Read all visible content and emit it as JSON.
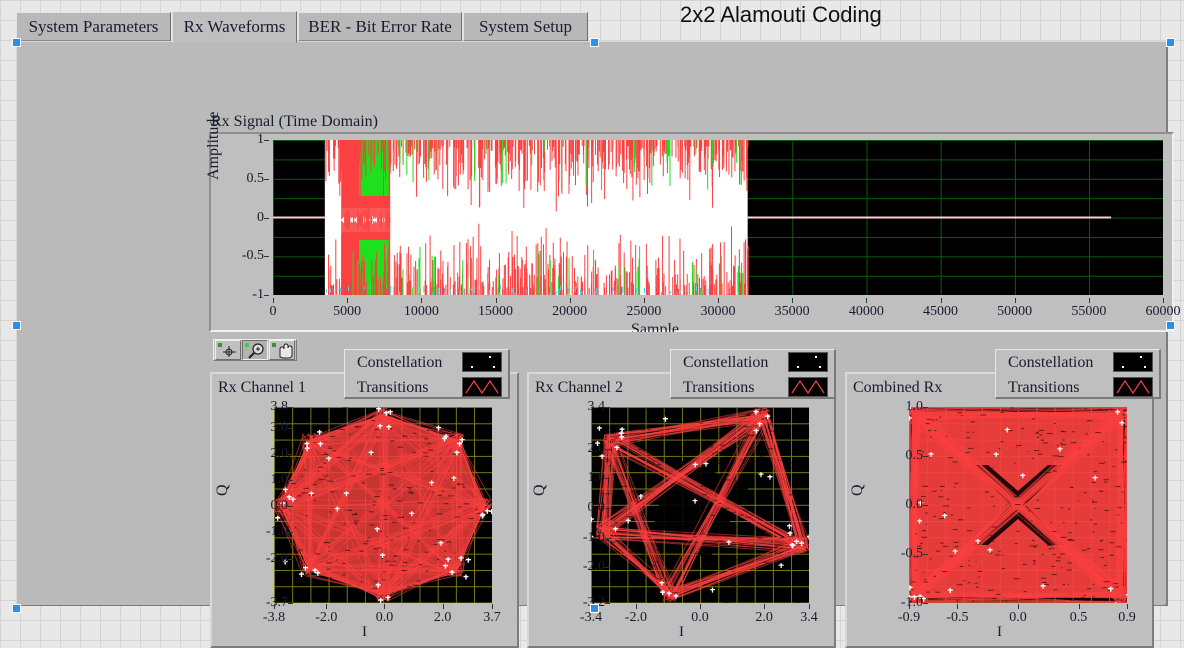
{
  "window": {
    "title": "2x2 Alamouti Coding"
  },
  "tabs": [
    {
      "label": "System Parameters",
      "active": false
    },
    {
      "label": "Rx Waveforms",
      "active": true
    },
    {
      "label": "BER - Bit Error Rate",
      "active": false
    },
    {
      "label": "System Setup",
      "active": false
    }
  ],
  "graph_palette": {
    "buttons": [
      {
        "name": "cursor-tool",
        "icon": "crosshair-icon",
        "pressed": false
      },
      {
        "name": "zoom-tool",
        "icon": "magnifier-icon",
        "pressed": true
      },
      {
        "name": "pan-tool",
        "icon": "hand-icon",
        "pressed": false
      }
    ]
  },
  "legend": {
    "rows": [
      {
        "label": "Constellation",
        "swatch": "scatter-dots-swatch"
      },
      {
        "label": "Transitions",
        "swatch": "zigzag-line-swatch"
      }
    ]
  },
  "colors": {
    "panel": "#bababa",
    "plot_background": "#000000",
    "waveform_grid": "#0b5e0b",
    "constellation_grid": "#7a7a18",
    "trace_red": "#fa4040",
    "trace_green": "#1ee01e",
    "trace_white": "#ffffff",
    "trace_cyan": "#3fd5f0",
    "selection_handle": "#2f8fe8"
  },
  "chart_data": [
    {
      "id": "rx-signal-time-domain",
      "type": "line",
      "title": "Rx Signal (Time Domain)",
      "xlabel": "Sample",
      "ylabel": "Amplitude",
      "xlim": [
        0,
        60000
      ],
      "ylim": [
        -1,
        1
      ],
      "xticks": [
        0,
        5000,
        10000,
        15000,
        20000,
        25000,
        30000,
        35000,
        40000,
        45000,
        50000,
        55000,
        60000
      ],
      "xtick_labels": [
        "0",
        "5000",
        "10000",
        "15000",
        "20000",
        "25000",
        "30000",
        "35000",
        "40000",
        "45000",
        "50000",
        "55000",
        "60000"
      ],
      "yticks": [
        1,
        0.5,
        0,
        -0.5,
        -1
      ],
      "ytick_labels": [
        "1",
        "0.5",
        "0",
        "-0.5",
        "-1"
      ],
      "grid": true,
      "legend": "none",
      "series": [
        {
          "name": "trace-red",
          "color": "#fa4040"
        },
        {
          "name": "trace-green",
          "color": "#1ee01e"
        },
        {
          "name": "trace-white",
          "color": "#ffffff"
        },
        {
          "name": "trace-cyan",
          "color": "#3fd5f0"
        }
      ],
      "description": "Dense multi-trace receive waveform. Flat zero line from sample 0 to ~3500, full-scale noisy burst from ~3500 to ~32000 (saturated white envelope with red spikes and solid green blocks near samples 5800-7800), then flat zero line to ~56500 and silence to 60000."
    },
    {
      "id": "rx-channel-1-constellation",
      "type": "scatter",
      "title": "Rx Channel 1",
      "xlabel": "I",
      "ylabel": "Q",
      "xlim": [
        -3.8,
        3.7
      ],
      "ylim": [
        -3.7,
        3.8
      ],
      "xticks": [
        -3.8,
        -2.0,
        0.0,
        2.0,
        3.7
      ],
      "xtick_labels": [
        "-3.8",
        "-2.0",
        "0.0",
        "2.0",
        "3.7"
      ],
      "yticks": [
        3.8,
        3.0,
        2.0,
        1.0,
        0.0,
        -1.0,
        -2.0,
        -3.7
      ],
      "ytick_labels": [
        "3.8",
        "3.0",
        "2.0",
        "1.0",
        "0.0",
        "-1.0",
        "-2.0",
        "-3.7"
      ],
      "grid": true,
      "grid_color": "#7a7a18",
      "trace_color": "#fa4040",
      "point_color": "#ffffff",
      "description": "Octagonal/diamond dense transition cloud filling the full I-Q range, with scattered white constellation symbol points near the outer vertices."
    },
    {
      "id": "rx-channel-2-constellation",
      "type": "scatter",
      "title": "Rx Channel 2",
      "xlabel": "I",
      "ylabel": "Q",
      "xlim": [
        -3.4,
        3.4
      ],
      "ylim": [
        -3.2,
        3.4
      ],
      "xticks": [
        -3.4,
        -2.0,
        0.0,
        2.0,
        3.4
      ],
      "xtick_labels": [
        "-3.4",
        "-2.0",
        "0.0",
        "2.0",
        "3.4"
      ],
      "yticks": [
        3.4,
        2.0,
        1.0,
        0.0,
        -1.0,
        -2.0,
        -3.2
      ],
      "ytick_labels": [
        "3.4",
        "2.0",
        "1.0",
        "0.0",
        "-1.0",
        "-2.0",
        "-3.2"
      ],
      "grid": true,
      "grid_color": "#7a7a18",
      "trace_color": "#fa4040",
      "point_color": "#ffffff",
      "description": "Rotated square / bow-tie transition trace outlining the constellation boundary with a hollow centre, white symbol markers at the corners."
    },
    {
      "id": "combined-rx-constellation",
      "type": "scatter",
      "title": "Combined Rx",
      "xlabel": "I",
      "ylabel": "Q",
      "xlim": [
        -0.9,
        0.9
      ],
      "ylim": [
        -1.0,
        1.0
      ],
      "xticks": [
        -0.9,
        -0.5,
        0.0,
        0.5,
        0.9
      ],
      "xtick_labels": [
        "-0.9",
        "-0.5",
        "0.0",
        "0.5",
        "0.9"
      ],
      "yticks": [
        1.0,
        0.5,
        0.0,
        -0.5,
        -1.0
      ],
      "ytick_labels": [
        "1.0",
        "0.5",
        "0.0",
        "-0.5",
        "-1.0"
      ],
      "grid": true,
      "grid_color": "#7a7a18",
      "trace_color": "#fa4040",
      "point_color": "#ffffff",
      "description": "Nearly square saturated transition cloud spanning the unit I-Q box with a dark X/star shaped hollow in the centre and white symbol markers along the edges."
    }
  ]
}
